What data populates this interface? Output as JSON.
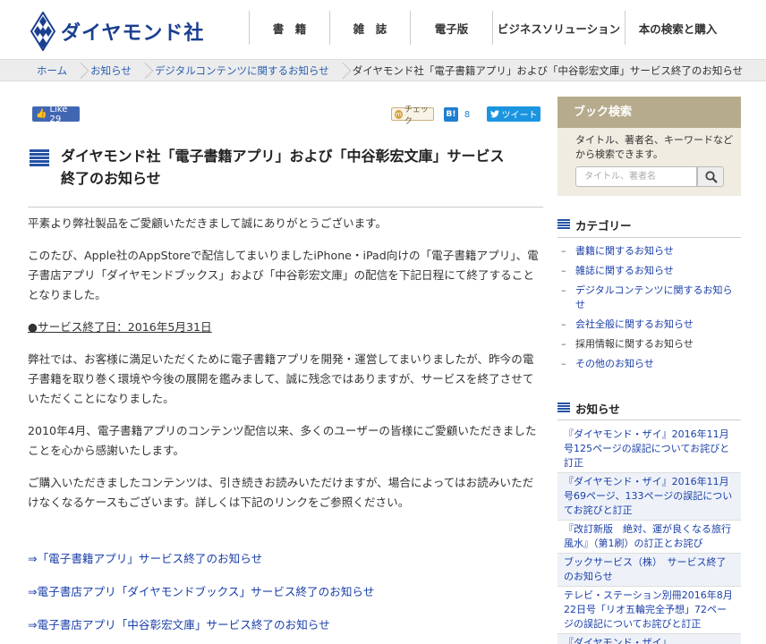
{
  "header": {
    "logo_text": "ダイヤモンド社",
    "nav": [
      "書　籍",
      "雑　誌",
      "電子版",
      "ビジネスソリューション",
      "本の検索と購入"
    ]
  },
  "breadcrumb": {
    "items": [
      "ホーム",
      "お知らせ",
      "デジタルコンテンツに関するお知らせ"
    ],
    "current": "ダイヤモンド社「電子書籍アプリ」および「中谷彰宏文庫」サービス終了のお知らせ"
  },
  "social": {
    "fb_like": "Like 29",
    "mixi_check": "チェック",
    "hatena_icon": "B!",
    "hatena_count": "8",
    "tweet": "ツイート"
  },
  "article": {
    "title_line1": "ダイヤモンド社「電子書籍アプリ」および「中谷彰宏文庫」サービス",
    "title_line2": "終了のお知らせ",
    "p1": "平素より弊社製品をご愛顧いただきまして誠にありがとうございます。",
    "p2": "このたび、Apple社のAppStoreで配信してまいりましたiPhone・iPad向けの「電子書籍アプリ」、電子書店アプリ「ダイヤモンドブックス」および「中谷彰宏文庫」の配信を下記日程にて終了することとなりました。",
    "end_date": "●サービス終了日：2016年5月31日",
    "p3": "弊社では、お客様に満足いただくために電子書籍アプリを開発・運営してまいりましたが、昨今の電子書籍を取り巻く環境や今後の展開を鑑みまして、誠に残念ではありますが、サービスを終了させていただくことになりました。",
    "p4": "2010年4月、電子書籍アプリのコンテンツ配信以来、多くのユーザーの皆様にご愛顧いただきましたことを心から感謝いたします。",
    "p5": "ご購入いただきましたコンテンツは、引き続きお読みいただけますが、場合によってはお読みいただけなくなるケースもございます。詳しくは下記のリンクをご参照ください。",
    "links": [
      "⇒「電子書籍アプリ」サービス終了のお知らせ",
      "⇒電子書店アプリ「ダイヤモンドブックス」サービス終了のお知らせ",
      "⇒電子書店アプリ「中谷彰宏文庫」サービス終了のお知らせ"
    ]
  },
  "sidebar": {
    "book_search": {
      "heading": "ブック検索",
      "desc": "タイトル、著者名、キーワードなどから検索できます。",
      "placeholder": "タイトル、著者名"
    },
    "category": {
      "heading": "カテゴリー",
      "items": [
        "書籍に関するお知らせ",
        "雑誌に関するお知らせ",
        "デジタルコンテンツに関するお知らせ",
        "会社全般に関するお知らせ",
        "採用情報に関するお知らせ",
        "その他のお知らせ"
      ]
    },
    "news": {
      "heading": "お知らせ",
      "items": [
        "『ダイヤモンド・ザイ』2016年11月号125ページの誤記についてお詫びと訂正",
        "『ダイヤモンド・ザイ』2016年11月号69ページ、133ページの誤記についてお詫びと訂正",
        "『改訂新版　絶対、運が良くなる旅行風水』（第1刷）の訂正とお詫び",
        "ブックサービス（株）　サービス終了のお知らせ",
        "テレビ・ステーション別冊2016年8月22日号「リオ五輪完全予想」72ページの誤記についてお詫びと訂正",
        "『ダイヤモンド・ザイ』"
      ]
    }
  }
}
